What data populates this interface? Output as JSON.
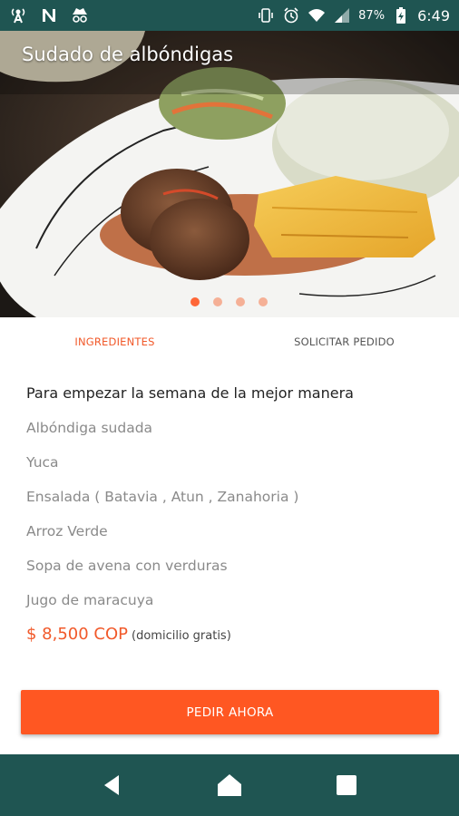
{
  "status_bar": {
    "left_icons": [
      "signal-tower-icon",
      "n-app-icon",
      "incognito-icon"
    ],
    "right_icons": [
      "vibrate-icon",
      "alarm-icon",
      "wifi-icon",
      "cell-signal-icon"
    ],
    "battery_percent": "87%",
    "time": "6:49"
  },
  "hero": {
    "title": "Sudado de albóndigas",
    "pager_total": 4,
    "pager_active": 1
  },
  "tabs": [
    {
      "label": "INGREDIENTES",
      "active": true
    },
    {
      "label": "SOLICITAR PEDIDO",
      "active": false
    }
  ],
  "details": {
    "heading": "Para empezar la semana de la mejor manera",
    "items": [
      "Albóndiga sudada",
      "Yuca",
      "Ensalada ( Batavia , Atun , Zanahoria )",
      "Arroz Verde",
      "Sopa de avena con verduras",
      "Jugo de maracuya"
    ],
    "price": "$ 8,500 COP",
    "price_note": "(domicilio gratis)"
  },
  "order_button": "PEDIR AHORA",
  "nav_bar": {
    "buttons": [
      "back-icon",
      "home-icon",
      "recents-icon"
    ]
  },
  "colors": {
    "accent": "#ff5722",
    "bars": "#1f5552"
  }
}
